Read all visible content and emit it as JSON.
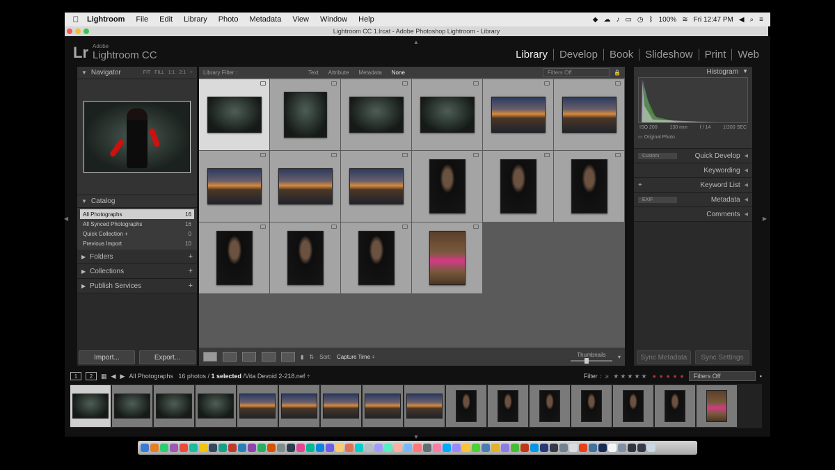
{
  "menubar": {
    "app": "Lightroom",
    "items": [
      "File",
      "Edit",
      "Library",
      "Photo",
      "Metadata",
      "View",
      "Window",
      "Help"
    ],
    "battery": "100%",
    "clock": "Fri 12:47 PM"
  },
  "window": {
    "title": "Lightroom CC 1.lrcat - Adobe Photoshop Lightroom - Library"
  },
  "identity": {
    "logo": "Lr",
    "brand_small": "Adobe",
    "brand": "Lightroom CC"
  },
  "modules": [
    "Library",
    "Develop",
    "Book",
    "Slideshow",
    "Print",
    "Web"
  ],
  "navigator": {
    "title": "Navigator",
    "zoom": "FIT  FILL  1:1  2:1 ÷"
  },
  "catalog": {
    "title": "Catalog",
    "rows": [
      {
        "label": "All Photographs",
        "count": "16"
      },
      {
        "label": "All Synced Photographs",
        "count": "16"
      },
      {
        "label": "Quick Collection +",
        "count": "0"
      },
      {
        "label": "Previous Import",
        "count": "10"
      }
    ]
  },
  "left_sections": [
    "Folders",
    "Collections",
    "Publish Services"
  ],
  "left_buttons": {
    "import": "Import...",
    "export": "Export..."
  },
  "library_filter": {
    "label": "Library Filter :",
    "options": [
      "Text",
      "Attribute",
      "Metadata",
      "None"
    ],
    "selected": "None",
    "status": "Filters Off"
  },
  "grid": [
    {
      "kind": "woman",
      "shape": "wide"
    },
    {
      "kind": "woman",
      "shape": "sq"
    },
    {
      "kind": "woman",
      "shape": "wide"
    },
    {
      "kind": "woman",
      "shape": "wide"
    },
    {
      "kind": "sunset",
      "shape": "wide"
    },
    {
      "kind": "sunset",
      "shape": "wide"
    },
    {
      "kind": "sunset",
      "shape": "wide"
    },
    {
      "kind": "sunset",
      "shape": "wide"
    },
    {
      "kind": "sunset",
      "shape": "wide"
    },
    {
      "kind": "man",
      "shape": "tall"
    },
    {
      "kind": "man",
      "shape": "tall"
    },
    {
      "kind": "man",
      "shape": "tall"
    },
    {
      "kind": "man",
      "shape": "tall"
    },
    {
      "kind": "man",
      "shape": "tall"
    },
    {
      "kind": "man",
      "shape": "tall"
    },
    {
      "kind": "girl",
      "shape": "tall"
    }
  ],
  "toolbar": {
    "sort_label": "Sort:",
    "sort_value": "Capture Time ÷",
    "thumbs_label": "Thumbnails"
  },
  "histogram": {
    "title": "Histogram",
    "iso": "ISO 200",
    "focal": "130 mm",
    "aperture": "f / 14",
    "shutter": "1/200 SEC",
    "original": "Original Photo"
  },
  "right_sections": [
    {
      "left": "Custom",
      "title": "Quick Develop"
    },
    {
      "left": "",
      "title": "Keywording"
    },
    {
      "left": "+",
      "title": "Keyword List"
    },
    {
      "left": "EXIF",
      "title": "Metadata"
    },
    {
      "left": "",
      "title": "Comments"
    }
  ],
  "right_buttons": {
    "sync_meta": "Sync Metadata",
    "sync_settings": "Sync Settings"
  },
  "filmstrip_bar": {
    "view1": "1",
    "view2": "2",
    "source": "All Photographs",
    "count": "16 photos /",
    "selected": "1 selected",
    "file": "/Vita Devoid 2-218.nef ÷",
    "filter_label": "Filter :",
    "stars": "≥ ★★★★★",
    "filter_value": "Filters Off"
  },
  "filmstrip": [
    "woman",
    "woman",
    "woman",
    "woman",
    "sunset",
    "sunset",
    "sunset",
    "sunset",
    "sunset",
    "man",
    "man",
    "man",
    "man",
    "man",
    "man",
    "girl"
  ],
  "colors": {
    "accent_red": "#c11111",
    "selected_row": "#cfcfcf"
  }
}
